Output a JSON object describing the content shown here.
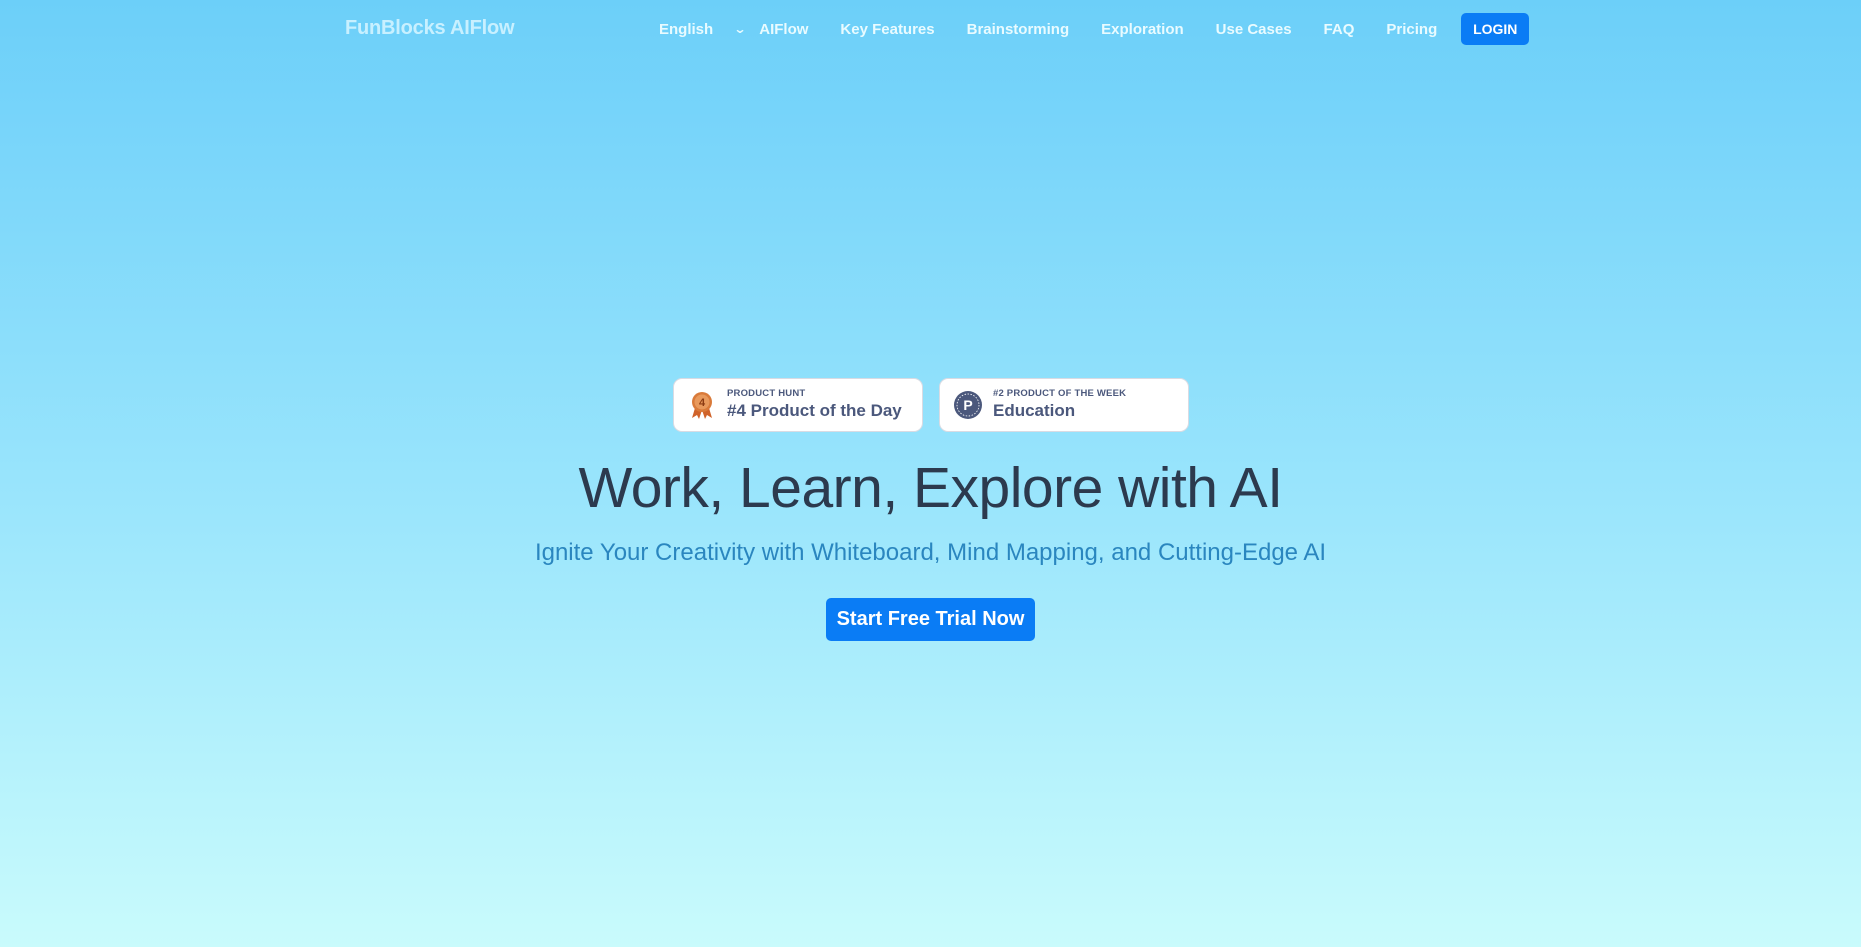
{
  "header": {
    "logo": "FunBlocks AIFlow",
    "language": "English",
    "nav": [
      "AIFlow",
      "Key Features",
      "Brainstorming",
      "Exploration",
      "Use Cases",
      "FAQ",
      "Pricing"
    ],
    "login": "LOGIN"
  },
  "badges": [
    {
      "top": "PRODUCT HUNT",
      "main": "#4 Product of the Day",
      "icon": "medal-icon",
      "rank": "4"
    },
    {
      "top": "#2 PRODUCT OF THE WEEK",
      "main": "Education",
      "icon": "product-hunt-icon",
      "letter": "P"
    }
  ],
  "hero": {
    "title": "Work, Learn, Explore with AI",
    "subtitle": "Ignite Your Creativity with Whiteboard, Mind Mapping, and Cutting-Edge AI",
    "cta": "Start Free Trial Now"
  },
  "colors": {
    "accent": "#0a7cf5",
    "title": "#2c3a4e",
    "subtitle": "#2a86bf",
    "badge_text": "#4b587c"
  }
}
